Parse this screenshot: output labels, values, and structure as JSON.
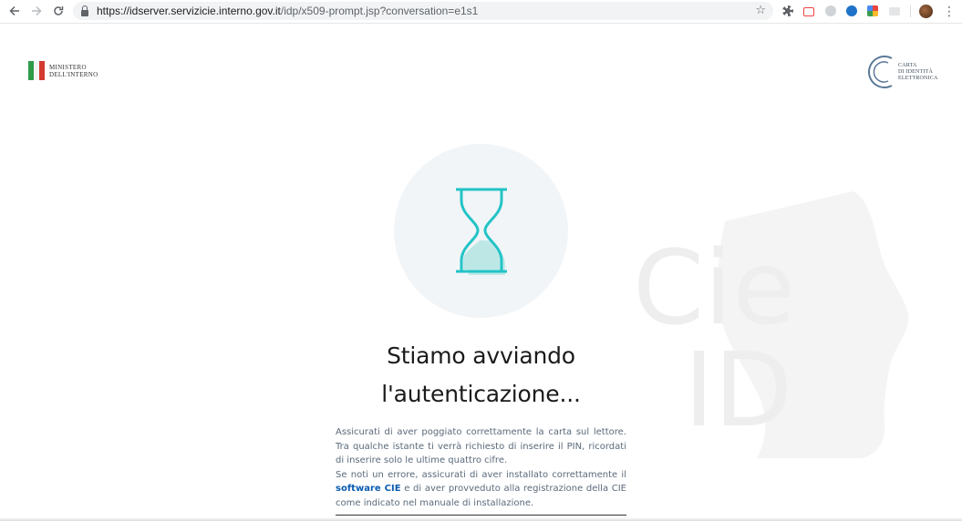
{
  "browser": {
    "url_host": "https://idserver.servizicie.interno.gov.it",
    "url_path": "/idp/x509-prompt.jsp?conversation=e1s1",
    "back_icon": "arrow-left-icon",
    "forward_icon": "arrow-right-icon",
    "reload_icon": "reload-icon",
    "bookmark_icon": "star-icon",
    "menu_icon": "kebab-menu-icon"
  },
  "header": {
    "ministero_line1": "MINISTERO",
    "ministero_line2": "DELL'INTERNO",
    "cie_line1": "CARTA",
    "cie_line2": "DI IDENTITÀ",
    "cie_line3": "ELETTRONICA"
  },
  "main": {
    "title_line1": "Stiamo avviando",
    "title_line2": "l'autenticazione...",
    "para1": "Assicurati di aver poggiato correttamente la carta sul lettore. Tra qualche istante ti verrà richiesto di inserire il PIN, ricordati di inserire solo le ultime quattro cifre.",
    "para2_before": "Se noti un errore, assicurati di aver installato correttamente il ",
    "para2_link": "software CIE",
    "para2_after": " e di aver provveduto alla registrazione della CIE come indicato nel manuale di installazione."
  },
  "watermark": {
    "line1": "Cie",
    "line2": "ID"
  },
  "colors": {
    "accent_teal": "#23c3c6",
    "hourglass_fill": "#bde7e5",
    "link_blue": "#0a5bb0",
    "cie_blue": "#5b7896",
    "flag_green": "#2e9a4a",
    "flag_red": "#d43a2f"
  }
}
